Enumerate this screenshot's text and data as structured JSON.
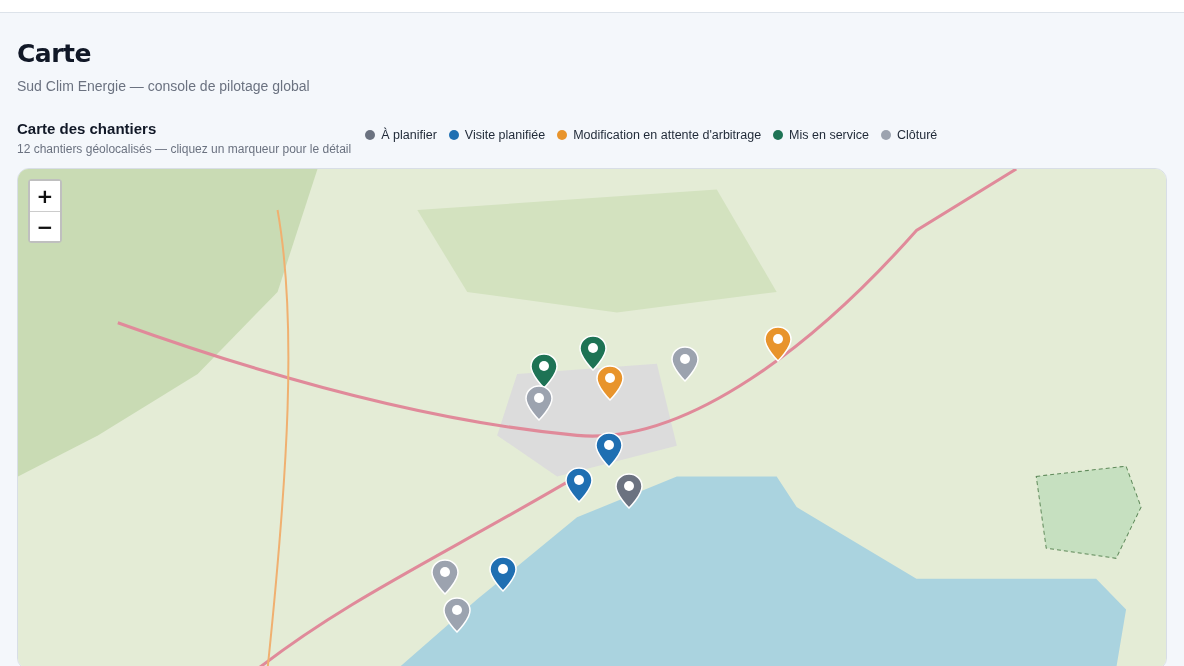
{
  "page": {
    "title": "Carte",
    "subtitle": "Sud Clim Energie — console de pilotage global"
  },
  "section": {
    "title": "Carte des chantiers",
    "subtitle": "12 chantiers géolocalisés — cliquez un marqueur pour le détail"
  },
  "legend": [
    {
      "label": "À planifier",
      "color": "#6b7280"
    },
    {
      "label": "Visite planifiée",
      "color": "#1f6fb2"
    },
    {
      "label": "Modification en attente d'arbitrage",
      "color": "#e8942c"
    },
    {
      "label": "Mis en service",
      "color": "#1e7355"
    },
    {
      "label": "Clôturé",
      "color": "#9ca3af"
    }
  ],
  "map": {
    "zoom_in": "+",
    "zoom_out": "−",
    "markers": [
      {
        "color": "#1e7355"
      },
      {
        "color": "#1e7355"
      },
      {
        "color": "#e8942c"
      },
      {
        "color": "#9ca3af"
      },
      {
        "color": "#9ca3af"
      },
      {
        "color": "#e8942c"
      },
      {
        "color": "#1f6fb2"
      },
      {
        "color": "#1f6fb2"
      },
      {
        "color": "#6b7280"
      },
      {
        "color": "#9ca3af"
      },
      {
        "color": "#1f6fb2"
      },
      {
        "color": "#9ca3af"
      }
    ]
  }
}
